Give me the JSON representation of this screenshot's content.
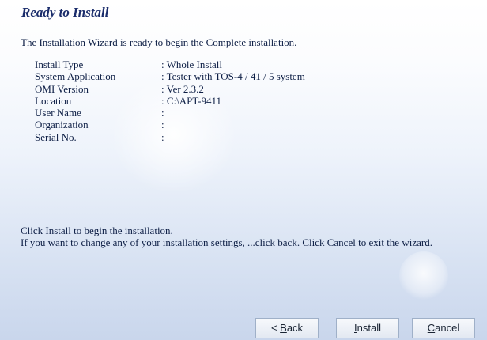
{
  "title": "Ready to Install",
  "intro": "The Installation Wizard is ready to begin the Complete installation.",
  "details": [
    {
      "label": "Install Type",
      "value": ": Whole Install"
    },
    {
      "label": "System Application",
      "value": ": Tester with TOS-4 / 41 / 5 system"
    },
    {
      "label": "OMI Version",
      "value": ": Ver 2.3.2"
    },
    {
      "label": "Location",
      "value": ": C:\\APT-9411"
    },
    {
      "label": "User Name",
      "value": ":"
    },
    {
      "label": "Organization",
      "value": ":"
    },
    {
      "label": "Serial No.",
      "value": ":"
    }
  ],
  "footer": {
    "line1": "Click Install to begin the installation.",
    "line2": "If you want to change any of your installation settings, ...click back. Click Cancel to exit the wizard."
  },
  "buttons": {
    "back_prefix": "< ",
    "back_mnemonic": "B",
    "back_rest": "ack",
    "install_mnemonic": "I",
    "install_rest": "nstall",
    "cancel_mnemonic": "C",
    "cancel_rest": "ancel"
  }
}
